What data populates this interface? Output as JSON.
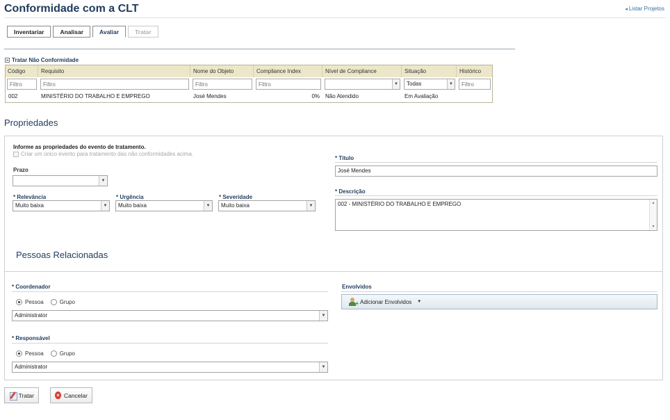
{
  "header": {
    "title": "Conformidade com a CLT",
    "list_link": "Listar Projetos"
  },
  "tabs": [
    {
      "label": "Inventariar",
      "state": "normal"
    },
    {
      "label": "Analisar",
      "state": "normal"
    },
    {
      "label": "Avaliar",
      "state": "active"
    },
    {
      "label": "Tratar",
      "state": "disabled"
    }
  ],
  "nonconformity": {
    "section_label": "Tratar Não Conformidade",
    "columns": [
      "Código",
      "Requisito",
      "Nome do Objeto",
      "Compliance Index",
      "Nível de Compliance",
      "Situação",
      "Histórico"
    ],
    "filter_placeholder": "Filtro",
    "situacao_filter_value": "Todas",
    "rows": [
      {
        "codigo": "002",
        "requisito": "MINISTÉRIO DO TRABALHO E EMPREGO",
        "nome_objeto": "José Mendes",
        "compliance_index": "0%",
        "nivel": "Não Atendido",
        "situacao": "Em Avaliação",
        "historico": ""
      }
    ]
  },
  "propriedades": {
    "title": "Propriedades",
    "instruction": "Informe as propriedades do evento de tratamento.",
    "single_event_checkbox": "Criar um único evento para tratamento das não conformidades acima.",
    "prazo_label": "Prazo",
    "prazo_value": "",
    "relevancia_label": "* Relevância",
    "relevancia_value": "Muito baixa",
    "urgencia_label": "* Urgência",
    "urgencia_value": "Muito baixa",
    "severidade_label": "* Severidade",
    "severidade_value": "Muito baixa",
    "titulo_label": "* Título",
    "titulo_value": "José Mendes",
    "descricao_label": "* Descrição",
    "descricao_value": "002 - MINISTÉRIO DO TRABALHO E EMPREGO"
  },
  "pessoas": {
    "title": "Pessoas Relacionadas",
    "coordenador_label": "* Coordenador",
    "responsavel_label": "* Responsável",
    "pessoa_label": "Pessoa",
    "grupo_label": "Grupo",
    "coordenador_value": "Administrator",
    "responsavel_value": "Administrator",
    "envolvidos_label": "Envolvidos",
    "add_envolvidos_label": "Adicionar Envolvidos"
  },
  "actions": {
    "tratar_label": "Tratar",
    "cancelar_label": "Cancelar"
  }
}
